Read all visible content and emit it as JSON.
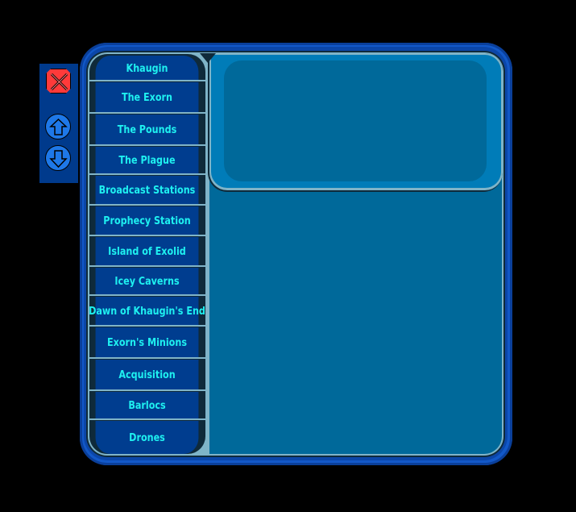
{
  "controls": {
    "close_icon": "close-x",
    "up_icon": "arrow-up",
    "down_icon": "arrow-down"
  },
  "colors": {
    "list_bg": "#003d8f",
    "list_text": "#1ef0f0",
    "content_bg": "#00699a",
    "close_btn": "#ff3a3a",
    "round_btn": "#1e78e8"
  },
  "list": {
    "items": [
      {
        "label": "Khaugin"
      },
      {
        "label": "The Exorn"
      },
      {
        "label": "The Pounds"
      },
      {
        "label": "The Plague"
      },
      {
        "label": "Broadcast Stations"
      },
      {
        "label": "Prophecy Station"
      },
      {
        "label": "Island of Exolid"
      },
      {
        "label": "Icey Caverns"
      },
      {
        "label": "Dawn of Khaugin's End"
      },
      {
        "label": "Exorn's Minions"
      },
      {
        "label": "Acquisition"
      },
      {
        "label": "Barlocs"
      },
      {
        "label": "Drones"
      }
    ]
  }
}
